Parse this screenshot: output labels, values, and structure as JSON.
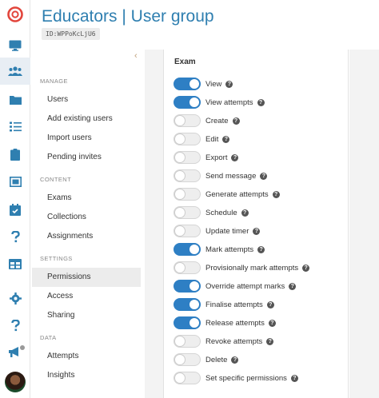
{
  "header": {
    "title": "Educators | User group",
    "id_badge": "ID:WPPoKcLjU6"
  },
  "rail": {
    "icons": [
      "logo-icon",
      "monitor-icon",
      "users-icon",
      "folder-icon",
      "checklist-icon",
      "clipboard-icon",
      "image-icon",
      "calendar-icon",
      "question-icon",
      "table-icon",
      "gear-icon",
      "help-icon",
      "megaphone-icon",
      "avatar"
    ]
  },
  "sidebar": {
    "collapse_glyph": "‹",
    "sections": [
      {
        "title": "MANAGE",
        "items": [
          "Users",
          "Add existing users",
          "Import users",
          "Pending invites"
        ]
      },
      {
        "title": "CONTENT",
        "items": [
          "Exams",
          "Collections",
          "Assignments"
        ]
      },
      {
        "title": "SETTINGS",
        "items": [
          "Permissions",
          "Access",
          "Sharing"
        ]
      },
      {
        "title": "DATA",
        "items": [
          "Attempts",
          "Insights"
        ]
      }
    ],
    "active_item": "Permissions"
  },
  "permissions": {
    "section_title": "Exam",
    "items": [
      {
        "label": "View",
        "on": true
      },
      {
        "label": "View attempts",
        "on": true
      },
      {
        "label": "Create",
        "on": false
      },
      {
        "label": "Edit",
        "on": false
      },
      {
        "label": "Export",
        "on": false
      },
      {
        "label": "Send message",
        "on": false
      },
      {
        "label": "Generate attempts",
        "on": false
      },
      {
        "label": "Schedule",
        "on": false
      },
      {
        "label": "Update timer",
        "on": false
      },
      {
        "label": "Mark attempts",
        "on": true
      },
      {
        "label": "Provisionally mark attempts",
        "on": false
      },
      {
        "label": "Override attempt marks",
        "on": true
      },
      {
        "label": "Finalise attempts",
        "on": true
      },
      {
        "label": "Release attempts",
        "on": true
      },
      {
        "label": "Revoke attempts",
        "on": false
      },
      {
        "label": "Delete",
        "on": false
      },
      {
        "label": "Set specific permissions",
        "on": false
      }
    ],
    "help_glyph": "?"
  },
  "colors": {
    "accent": "#2e7fc4",
    "title": "#2f7fb0",
    "logo": "#e2453c"
  }
}
